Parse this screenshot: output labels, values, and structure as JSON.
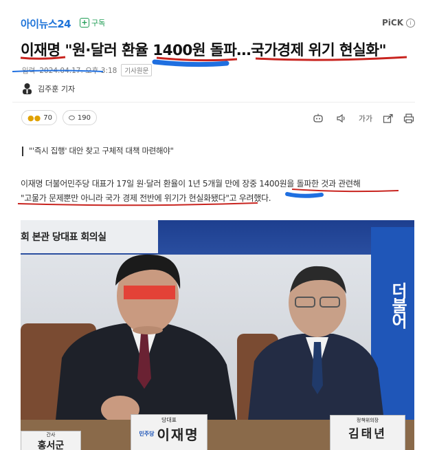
{
  "header": {
    "logo": "아이뉴스24",
    "subscribe_label": "구독",
    "pick_label": "PiCK"
  },
  "article": {
    "headline": "이재명 \"원·달러 환율 1400원 돌파…국가경제 위기 현실화\"",
    "date_label": "입력",
    "date": "2024.04.17. 오후 3:18",
    "origin_button": "기사원문",
    "author": "김주훈 기자",
    "subtitle": "\"'즉시 집행' 대안 찾고 구체적 대책 마련해야\"",
    "body_line1": "이재명 더불어민주당 대표가 17일 원·달러 환율이 1년 5개월 만에 장중 1400원을 돌파한 것과 관련해",
    "body_line2": "\"고물가 문제뿐만 아니라 국가 경제 전반에 위기가 현실화됐다\"고 우려했다."
  },
  "reactions": {
    "emoji_count": "70",
    "comment_count": "190"
  },
  "toolbar": {
    "font_size_label": "가가"
  },
  "photo": {
    "backdrop_text": "회 본관 당대표 회의실",
    "flag_text": "더불어",
    "nameplate_left_role": "당대표",
    "nameplate_left_party": "민주당",
    "nameplate_left_name": "이재명",
    "nameplate_right_role": "정책위의장",
    "nameplate_right_name": "김태년",
    "nameplate_far_left_role": "간사",
    "nameplate_far_left_name": "홍서군"
  },
  "colors": {
    "accent_blue": "#1e73d8",
    "subscribe_green": "#1e9c54",
    "underline_red": "#c8231e",
    "underline_blue": "#1f6fe0"
  }
}
